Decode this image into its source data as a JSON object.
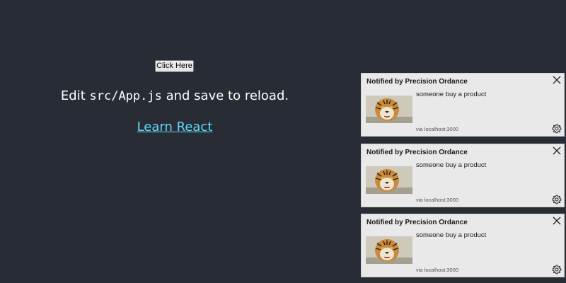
{
  "app": {
    "button_label": "Click Here",
    "edit_prefix": "Edit ",
    "edit_code": "src/App.js",
    "edit_suffix": " and save to reload.",
    "link_label": "Learn React",
    "colors": {
      "background": "#282c34",
      "text": "#ffffff",
      "link": "#61dafb"
    }
  },
  "notifications": [
    {
      "title": "Notified by Precision Ordance",
      "body": "someone buy a product",
      "source": "via localhost:3000",
      "image_icon": "tiger-image",
      "close_icon": "close-icon",
      "settings_icon": "gear-icon"
    },
    {
      "title": "Notified by Precision Ordance",
      "body": "someone buy a product",
      "source": "via localhost:3000",
      "image_icon": "tiger-image",
      "close_icon": "close-icon",
      "settings_icon": "gear-icon"
    },
    {
      "title": "Notified by Precision Ordance",
      "body": "someone buy a product",
      "source": "via localhost:3000",
      "image_icon": "tiger-image",
      "close_icon": "close-icon",
      "settings_icon": "gear-icon"
    }
  ]
}
